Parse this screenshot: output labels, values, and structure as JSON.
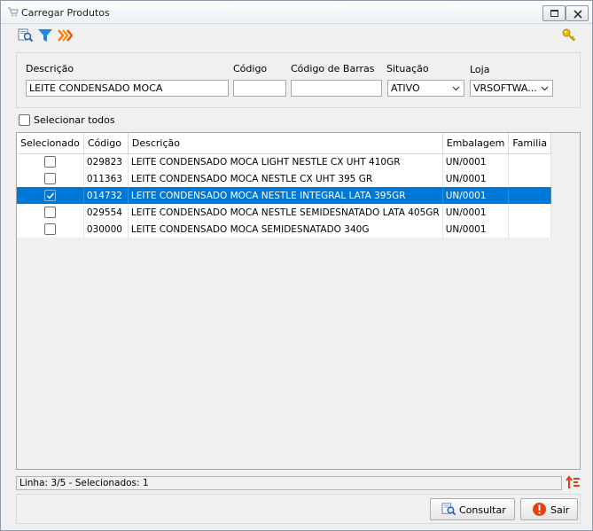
{
  "window": {
    "title": "Carregar Produtos"
  },
  "toolbar": {
    "icons": [
      "search-document-icon",
      "filter-icon",
      "chevrons-right-icon",
      "key-icon"
    ]
  },
  "filters": {
    "descricao": {
      "label": "Descrição",
      "value": "LEITE CONDENSADO MOCA",
      "placeholder": ""
    },
    "codigo": {
      "label": "Código",
      "value": "",
      "placeholder": ""
    },
    "codigo_barras": {
      "label": "Código de Barras",
      "value": "",
      "placeholder": ""
    },
    "situacao": {
      "label": "Situação",
      "value": "ATIVO"
    },
    "loja": {
      "label": "Loja",
      "value": "VRSOFTWA..."
    }
  },
  "select_all": {
    "label": "Selecionar todos",
    "checked": false
  },
  "table": {
    "columns": [
      "Selecionado",
      "Código",
      "Descrição",
      "Embalagem",
      "Familia"
    ],
    "rows": [
      {
        "selected": false,
        "codigo": "029823",
        "descricao": "LEITE CONDENSADO MOCA LIGHT NESTLE CX UHT 410GR",
        "embalagem": "UN/0001",
        "familia": ""
      },
      {
        "selected": false,
        "codigo": "011363",
        "descricao": "LEITE CONDENSADO MOCA NESTLE CX UHT 395 GR",
        "embalagem": "UN/0001",
        "familia": ""
      },
      {
        "selected": true,
        "codigo": "014732",
        "descricao": "LEITE CONDENSADO MOCA NESTLE INTEGRAL LATA 395GR",
        "embalagem": "UN/0001",
        "familia": ""
      },
      {
        "selected": false,
        "codigo": "029554",
        "descricao": "LEITE CONDENSADO MOCA NESTLE SEMIDESNATADO LATA 405GR",
        "embalagem": "UN/0001",
        "familia": ""
      },
      {
        "selected": false,
        "codigo": "030000",
        "descricao": "LEITE CONDENSADO MOCA SEMIDESNATADO 340G",
        "embalagem": "UN/0001",
        "familia": ""
      }
    ]
  },
  "status": {
    "text": "Linha: 3/5 - Selecionados: 1"
  },
  "buttons": {
    "consultar": "Consultar",
    "sair": "Sair"
  },
  "colors": {
    "selection": "#0078d7",
    "filter_icon": "#1e88e5",
    "chevrons": "#ff6f00",
    "key": "#f2b705",
    "exit": "#e8400c"
  }
}
